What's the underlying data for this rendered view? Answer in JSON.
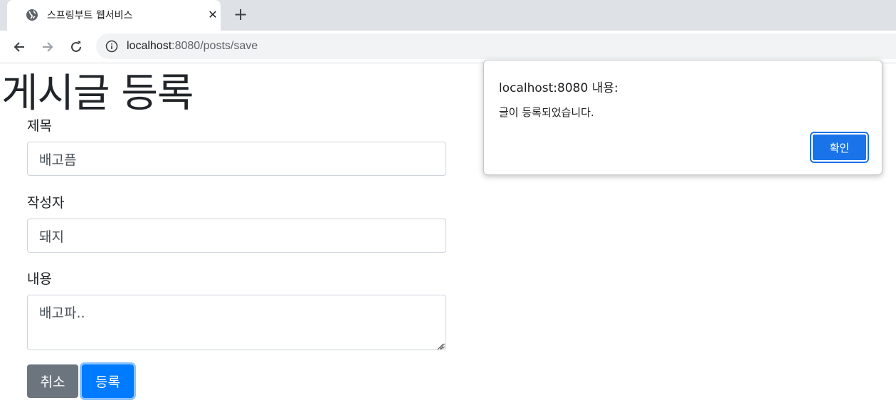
{
  "browser": {
    "tab_title": "스프링부트 웹서비스",
    "url_host": "localhost",
    "url_path": ":8080/posts/save"
  },
  "page": {
    "title": "게시글 등록",
    "form": {
      "title_label": "제목",
      "title_value": "배고픔",
      "author_label": "작성자",
      "author_value": "돼지",
      "content_label": "내용",
      "content_value": "배고파.."
    },
    "buttons": {
      "cancel": "취소",
      "submit": "등록"
    }
  },
  "dialog": {
    "origin": "localhost:8080 내용:",
    "message": "글이 등록되었습니다.",
    "ok": "확인"
  },
  "colors": {
    "primary": "#007bff",
    "secondary": "#6c757d",
    "dialog_button": "#1a73e8"
  },
  "icons": {
    "tab": "globe-icon",
    "close": "close-icon",
    "new_tab": "plus-icon",
    "back": "back-arrow-icon",
    "forward": "forward-arrow-icon",
    "reload": "reload-icon",
    "site_info": "info-icon"
  }
}
